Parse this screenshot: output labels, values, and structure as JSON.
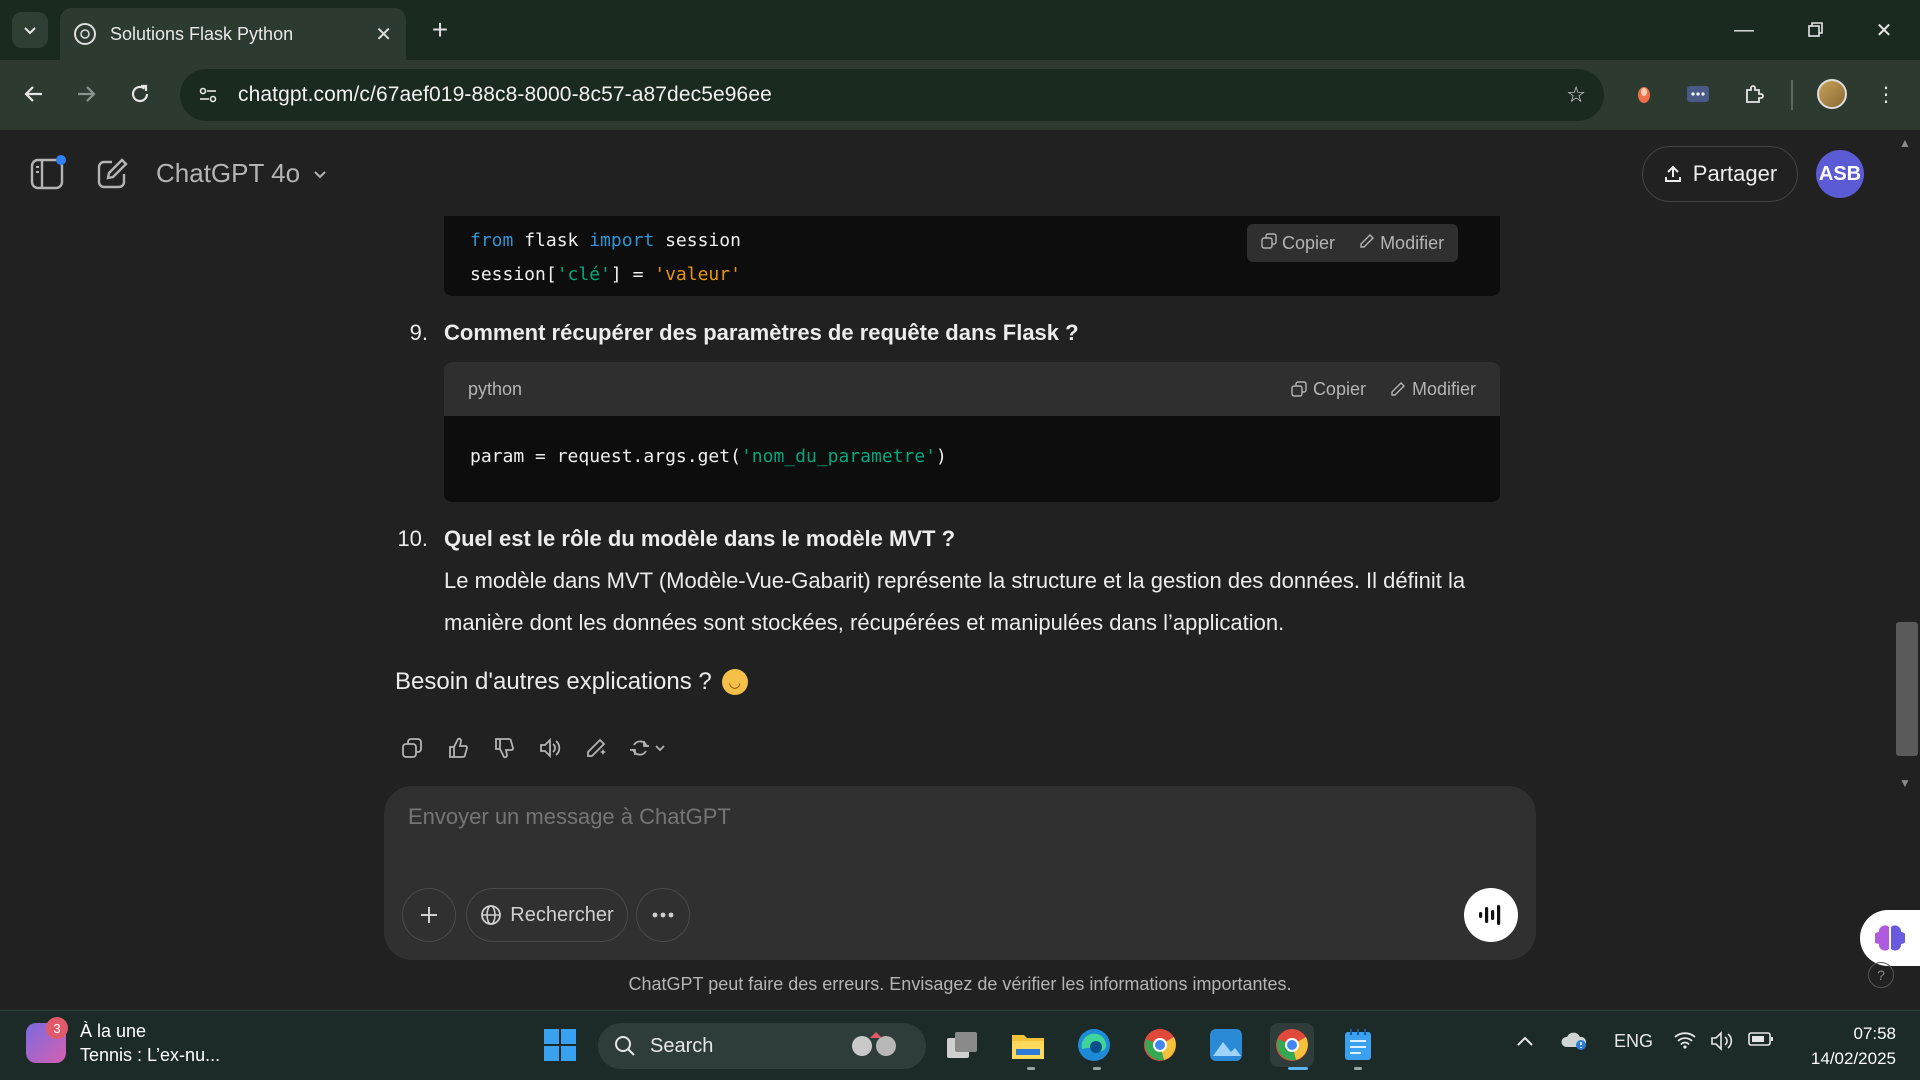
{
  "browser": {
    "tab_title": "Solutions Flask Python",
    "url": "chatgpt.com/c/67aef019-88c8-8000-8c57-a87dec5e96ee"
  },
  "header": {
    "model": "ChatGPT 4o",
    "share_label": "Partager",
    "avatar_initials": "ASB"
  },
  "code_block_1": {
    "line1_kw1": "from",
    "line1_mid": " flask ",
    "line1_kw2": "import",
    "line1_end": " session",
    "line2_a": "session[",
    "line2_key": "'clé'",
    "line2_b": "] = ",
    "line2_val": "'valeur'",
    "copy_label": "Copier",
    "edit_label": "Modifier"
  },
  "item9": {
    "number": "9.",
    "question": "Comment récupérer des paramètres de requête dans Flask ?"
  },
  "code_block_2": {
    "lang": "python",
    "copy_label": "Copier",
    "edit_label": "Modifier",
    "code_a": "param = request.args.get(",
    "code_str": "'nom_du_parametre'",
    "code_b": ")"
  },
  "item10": {
    "number": "10.",
    "question": "Quel est le rôle du modèle dans le modèle MVT ?",
    "answer": "Le modèle dans MVT (Modèle-Vue-Gabarit) représente la structure et la gestion des données. Il définit la manière dont les données sont stockées, récupérées et manipulées dans l’application."
  },
  "closing": "Besoin d'autres explications ?",
  "composer": {
    "placeholder": "Envoyer un message à ChatGPT",
    "search_label": "Rechercher"
  },
  "disclaimer": "ChatGPT peut faire des erreurs. Envisagez de vérifier les informations importantes.",
  "taskbar": {
    "news_badge": "3",
    "news_title": "À la une",
    "news_sub": "Tennis : L’ex-nu...",
    "search_label": "Search",
    "lang": "ENG",
    "time": "07:58",
    "date": "14/02/2025"
  }
}
